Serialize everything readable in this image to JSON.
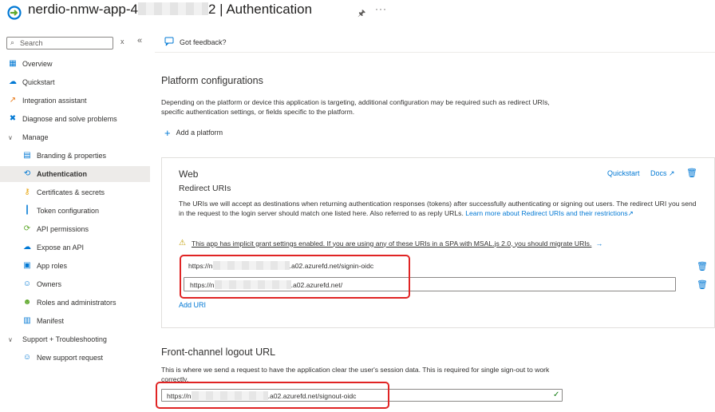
{
  "header": {
    "title_prefix": "nerdio-nmw-app-4",
    "title_suffix": "2 | Authentication",
    "pin_icon": "pin-icon",
    "more_icon": "ellipsis-icon"
  },
  "sidebar": {
    "search_placeholder": "Search",
    "clear_label": "x",
    "collapse_label": "«",
    "items": [
      {
        "label": "Overview",
        "icon": "overview-icon"
      },
      {
        "label": "Quickstart",
        "icon": "quickstart-icon"
      },
      {
        "label": "Integration assistant",
        "icon": "rocket-icon"
      },
      {
        "label": "Diagnose and solve problems",
        "icon": "wrench-icon"
      },
      {
        "label": "Manage",
        "icon": "chevron-down-icon"
      },
      {
        "label": "Branding & properties",
        "icon": "branding-icon"
      },
      {
        "label": "Authentication",
        "icon": "authentication-icon"
      },
      {
        "label": "Certificates & secrets",
        "icon": "key-icon"
      },
      {
        "label": "Token configuration",
        "icon": "token-icon"
      },
      {
        "label": "API permissions",
        "icon": "api-permissions-icon"
      },
      {
        "label": "Expose an API",
        "icon": "cloud-icon"
      },
      {
        "label": "App roles",
        "icon": "app-roles-icon"
      },
      {
        "label": "Owners",
        "icon": "owners-icon"
      },
      {
        "label": "Roles and administrators",
        "icon": "roles-icon"
      },
      {
        "label": "Manifest",
        "icon": "manifest-icon"
      },
      {
        "label": "Support + Troubleshooting",
        "icon": "chevron-down-icon"
      },
      {
        "label": "New support request",
        "icon": "support-icon"
      }
    ]
  },
  "cmdbar": {
    "feedback_label": "Got feedback?"
  },
  "main": {
    "platform_title": "Platform configurations",
    "platform_desc": "Depending on the platform or device this application is targeting, additional configuration may be required such as redirect URIs, specific authentication settings, or fields specific to the platform.",
    "add_platform_label": "Add a platform",
    "web": {
      "title": "Web",
      "subtitle": "Redirect URIs",
      "quickstart_label": "Quickstart",
      "docs_label": "Docs",
      "desc": "The URIs we will accept as destinations when returning authentication responses (tokens) after successfully authenticating or signing out users. The redirect URI you send in the request to the login server should match one listed here. Also referred to as reply URLs.",
      "learn_more": "Learn more about Redirect URIs and their restrictions",
      "warning": "This app has implicit grant settings enabled. If you are using any of these URIs in a SPA with MSAL.js 2.0, you should migrate URIs.",
      "uri1_prefix": "https://n",
      "uri1_suffix": ".a02.azurefd.net/signin-oidc",
      "uri2_prefix": "https://n",
      "uri2_suffix": ".a02.azurefd.net/",
      "add_uri_label": "Add URI"
    },
    "logout_title": "Front-channel logout URL",
    "logout_desc": "This is where we send a request to have the application clear the user's session data. This is required for single sign-out to work correctly.",
    "logout_prefix": "https://n",
    "logout_suffix": ".a02.azurefd.net/signout-oidc"
  },
  "colors": {
    "accent": "#0078d4",
    "highlight": "#e02424",
    "warning": "#c19c00",
    "success": "#107c10"
  }
}
